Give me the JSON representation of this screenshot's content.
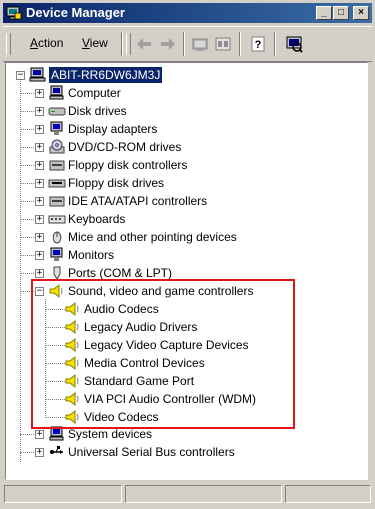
{
  "window": {
    "title": "Device Manager"
  },
  "title_buttons": {
    "minimize": "_",
    "maximize": "□",
    "close": "×"
  },
  "menu": [
    {
      "label_prefix": "",
      "accel": "A",
      "label_rest": "ction"
    },
    {
      "label_prefix": "",
      "accel": "V",
      "label_rest": "iew"
    }
  ],
  "toolbar_icons": [
    "back-arrow-icon",
    "forward-arrow-icon",
    "computer-folder-icon",
    "properties-icon",
    "help-icon",
    "scan-hardware-icon"
  ],
  "tree": {
    "root": "ABIT-RR6DW6JM3J",
    "categories": [
      {
        "label": "Computer",
        "icon": "computer-icon"
      },
      {
        "label": "Disk drives",
        "icon": "disk-drive-icon"
      },
      {
        "label": "Display adapters",
        "icon": "display-adapter-icon"
      },
      {
        "label": "DVD/CD-ROM drives",
        "icon": "cdrom-icon"
      },
      {
        "label": "Floppy disk controllers",
        "icon": "floppy-controller-icon"
      },
      {
        "label": "Floppy disk drives",
        "icon": "floppy-drive-icon"
      },
      {
        "label": "IDE ATA/ATAPI controllers",
        "icon": "ide-controller-icon"
      },
      {
        "label": "Keyboards",
        "icon": "keyboard-icon"
      },
      {
        "label": "Mice and other pointing devices",
        "icon": "mouse-icon"
      },
      {
        "label": "Monitors",
        "icon": "monitor-icon"
      },
      {
        "label": "Ports (COM & LPT)",
        "icon": "port-icon"
      }
    ],
    "expanded": {
      "label": "Sound, video and game controllers",
      "icon": "speaker-icon",
      "children": [
        "Audio Codecs",
        "Legacy Audio Drivers",
        "Legacy Video Capture Devices",
        "Media Control Devices",
        "Standard Game Port",
        "VIA PCI Audio Controller (WDM)",
        "Video Codecs"
      ]
    },
    "after": [
      {
        "label": "System devices",
        "icon": "system-devices-icon"
      },
      {
        "label": "Universal Serial Bus controllers",
        "icon": "usb-icon"
      }
    ]
  },
  "colors": {
    "selection": "#0a246a",
    "highlight_box": "#e0161a",
    "title_start": "#0a246a",
    "title_end": "#3a6ea5"
  }
}
